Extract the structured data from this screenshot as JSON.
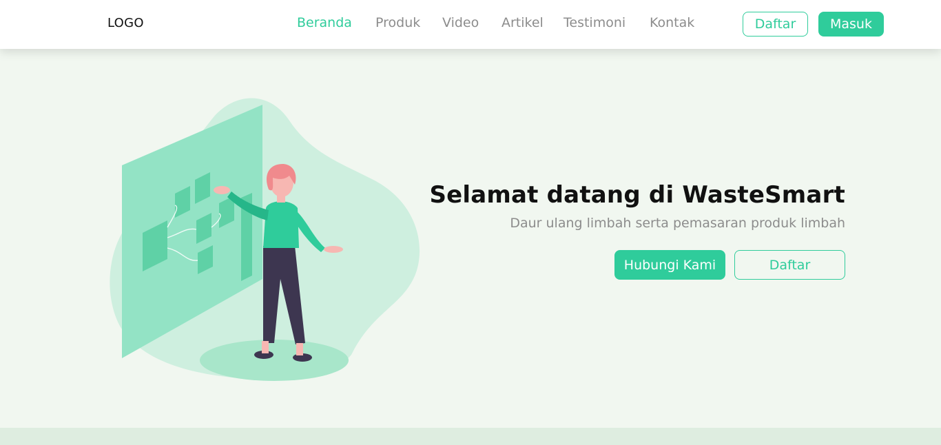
{
  "nav": {
    "logo": "LOGO",
    "links": [
      {
        "label": "Beranda",
        "active": true
      },
      {
        "label": "Produk",
        "active": false
      },
      {
        "label": "Video",
        "active": false
      },
      {
        "label": "Artikel",
        "active": false
      },
      {
        "label": "Testimoni",
        "active": false
      },
      {
        "label": "Kontak",
        "active": false
      }
    ],
    "register_label": "Daftar",
    "login_label": "Masuk"
  },
  "hero": {
    "title": "Selamat datang di WasteSmart",
    "subtitle": "Daur ulang limbah serta pemasaran produk limbah",
    "contact_button": "Hubungi Kami",
    "register_button": "Daftar",
    "illustration_icon": "woman-presenting-board-illustration"
  },
  "colors": {
    "accent": "#2fcc9b",
    "background": "#f1f7f0",
    "navbar": "#ffffff",
    "muted_text": "#8c8c8c",
    "footer_strip": "#deede0"
  }
}
